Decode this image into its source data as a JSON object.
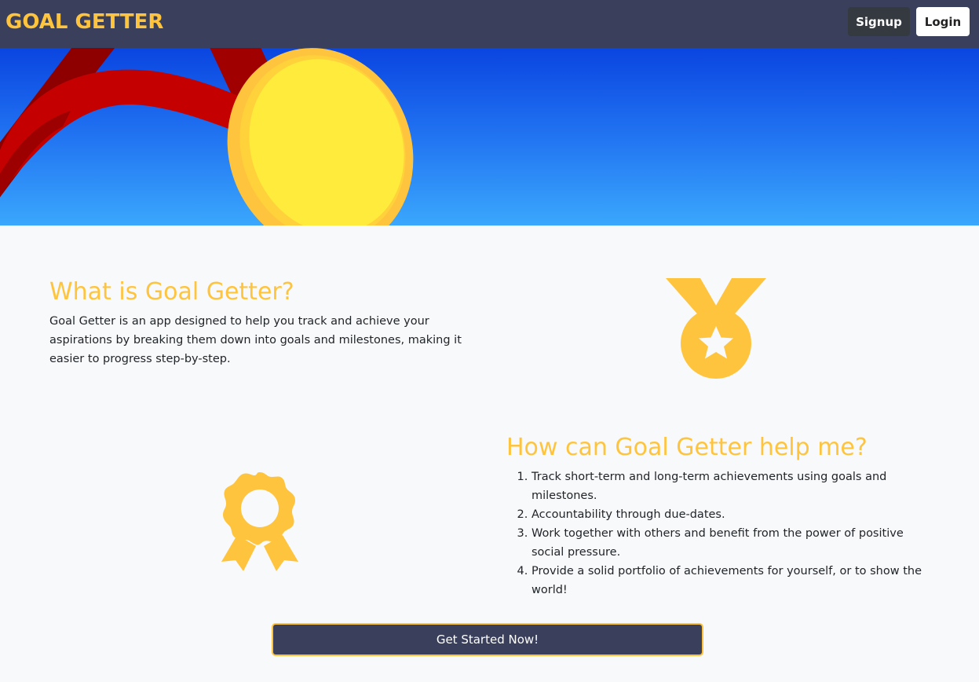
{
  "navbar": {
    "brand": "GOAL GETTER",
    "signup_label": "Signup",
    "login_label": "Login"
  },
  "hero": {
    "image": "gold-medal-with-red-ribbon-illustration"
  },
  "about": {
    "heading": "What is Goal Getter?",
    "body": "Goal Getter is an app designed to help you track and achieve your aspirations by breaking them down into goals and milestones, making it easier to progress step-by-step.",
    "icon": "medal-star-icon"
  },
  "help": {
    "heading": "How can Goal Getter help me?",
    "icon": "award-ribbon-icon",
    "items": [
      "Track short-term and long-term achievements using goals and milestones.",
      "Accountability through due-dates.",
      "Work together with others and benefit from the power of positive social pressure.",
      "Provide a solid portfolio of achievements for yourself, or to show the world!"
    ]
  },
  "cta": {
    "label": "Get Started Now!"
  },
  "colors": {
    "navbar_bg": "#3a405c",
    "accent": "#ffc43d",
    "page_bg": "#f8f9fa",
    "hero_top": "#0a45e0",
    "hero_bottom": "#3aa7fc",
    "ribbon": "#c40000",
    "medal": "#ffeb3b"
  }
}
